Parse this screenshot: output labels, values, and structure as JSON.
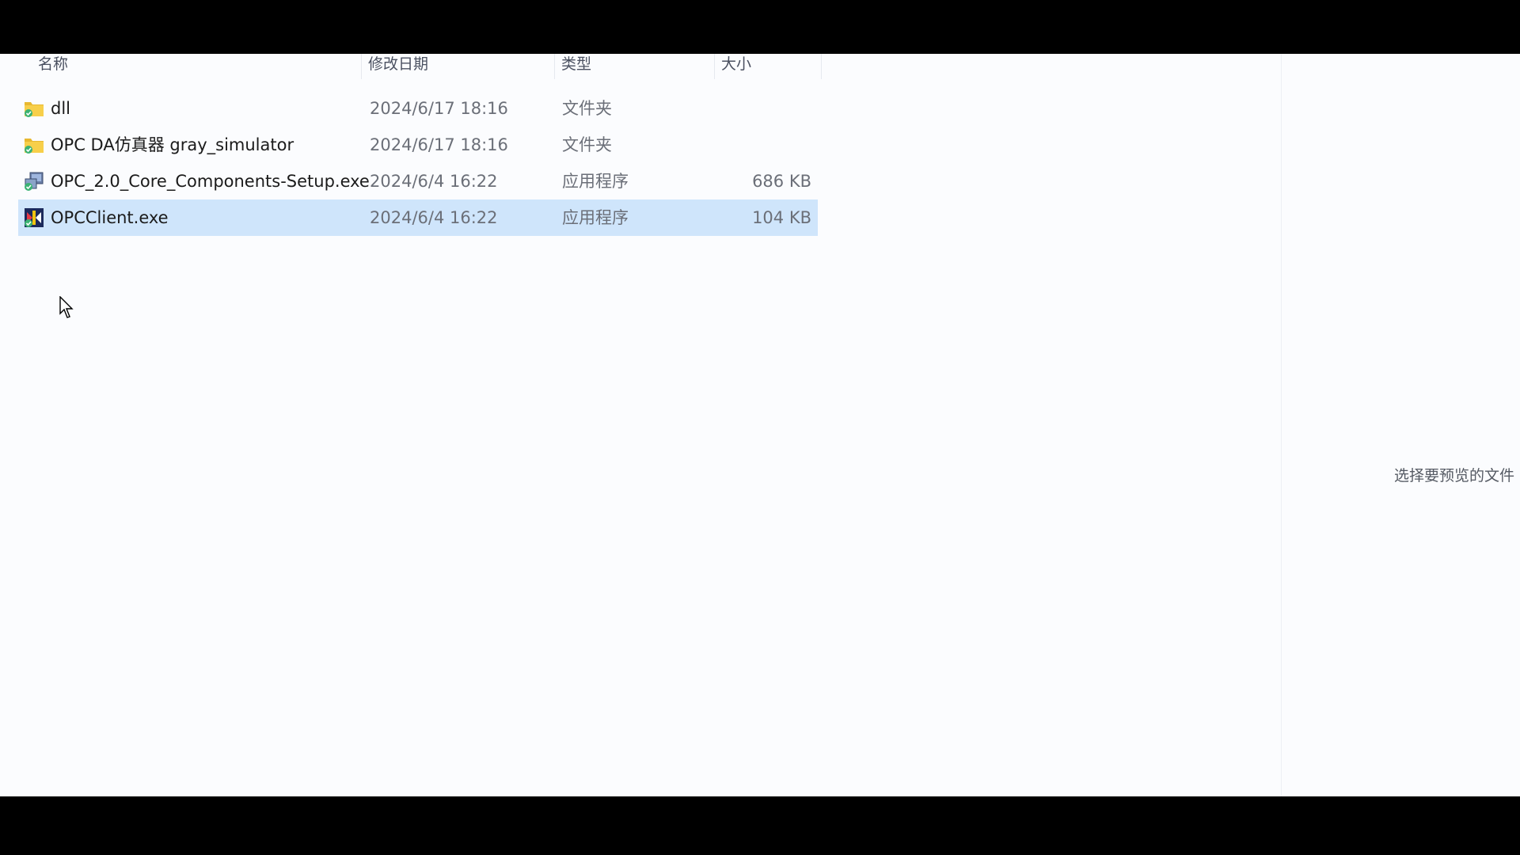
{
  "columns": {
    "name": "名称",
    "date": "修改日期",
    "type": "类型",
    "size": "大小"
  },
  "files": [
    {
      "name": "dll",
      "date": "2024/6/17 18:16",
      "type": "文件夹",
      "size": "",
      "icon": "folder-icon"
    },
    {
      "name": "OPC DA仿真器 gray_simulator",
      "date": "2024/6/17 18:16",
      "type": "文件夹",
      "size": "",
      "icon": "folder-icon"
    },
    {
      "name": "OPC_2.0_Core_Components-Setup.exe",
      "date": "2024/6/4 16:22",
      "type": "应用程序",
      "size": "686 KB",
      "icon": "installer-icon"
    },
    {
      "name": "OPCClient.exe",
      "date": "2024/6/4 16:22",
      "type": "应用程序",
      "size": "104 KB",
      "icon": "app-icon",
      "selected": true
    }
  ],
  "preview": {
    "message": "选择要预览的文件"
  },
  "colors": {
    "selection": "#cfe5fb",
    "folder": "#f4c542",
    "background": "#fbfcfe"
  }
}
